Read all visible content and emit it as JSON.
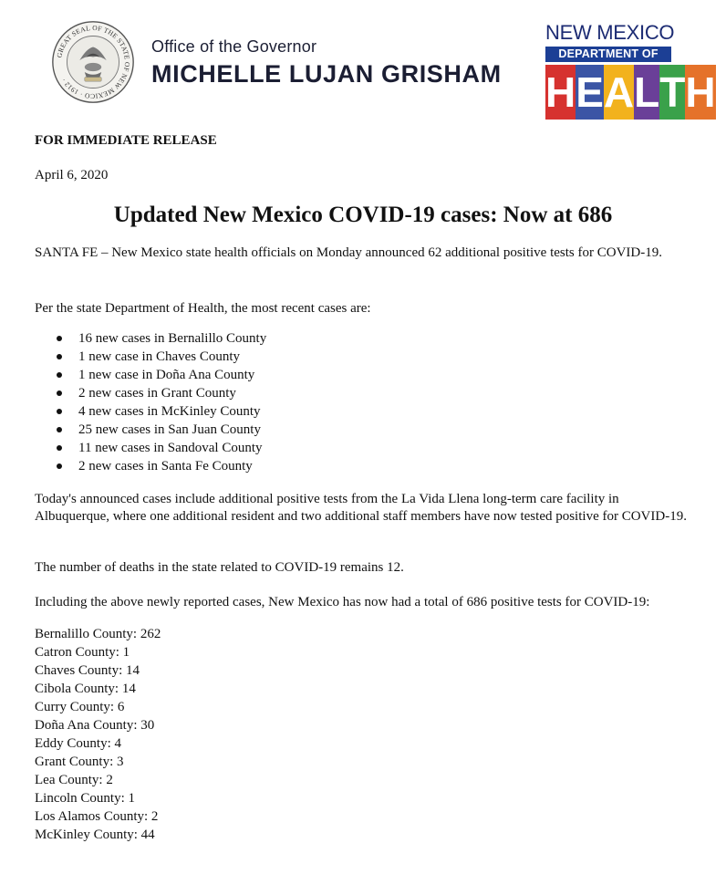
{
  "header": {
    "office": "Office of the Governor",
    "governor": "MICHELLE LUJAN GRISHAM",
    "seal_text": "GREAT SEAL OF THE STATE OF NEW MEXICO · 1912 ·",
    "doh": {
      "line1": "NEW MEXICO",
      "line2": "DEPARTMENT OF",
      "letters": [
        "H",
        "E",
        "A",
        "L",
        "T",
        "H"
      ],
      "letter_colors": [
        "#d6322f",
        "#3b55a5",
        "#f2b21d",
        "#6a3f98",
        "#3aa14a",
        "#e5722a"
      ]
    }
  },
  "release": "FOR IMMEDIATE RELEASE",
  "date": "April 6, 2020",
  "headline": "Updated New Mexico COVID-19 cases: Now at 686",
  "paragraphs": {
    "p1": "SANTA FE – New Mexico state health officials on Monday announced 62 additional positive tests for COVID-19.",
    "p2": "Per the state Department of Health, the most recent cases are:",
    "p3": "Today's announced cases include additional positive tests from the La Vida Llena long-term care facility in Albuquerque, where one additional resident and two additional staff members have now tested positive for COVID-19.",
    "p4": "The number of deaths in the state related to COVID-19 remains 12.",
    "p5": "Including the above newly reported cases, New Mexico has now had a total of 686 positive tests for COVID-19:"
  },
  "new_cases": [
    "16 new cases in Bernalillo County",
    "1 new case in Chaves County",
    "1 new case in Doña Ana County",
    "2 new cases in Grant County",
    "4 new cases in McKinley County",
    "25 new cases in San Juan County",
    "11 new cases in Sandoval County",
    "2 new cases in Santa Fe County"
  ],
  "county_totals": [
    "Bernalillo County: 262",
    "Catron County: 1",
    "Chaves County: 14",
    "Cibola County: 14",
    "Curry County: 6",
    "Doña Ana County: 30",
    "Eddy County: 4",
    "Grant County: 3",
    "Lea County: 2",
    "Lincoln County: 1",
    "Los Alamos County: 2",
    "McKinley County: 44"
  ]
}
